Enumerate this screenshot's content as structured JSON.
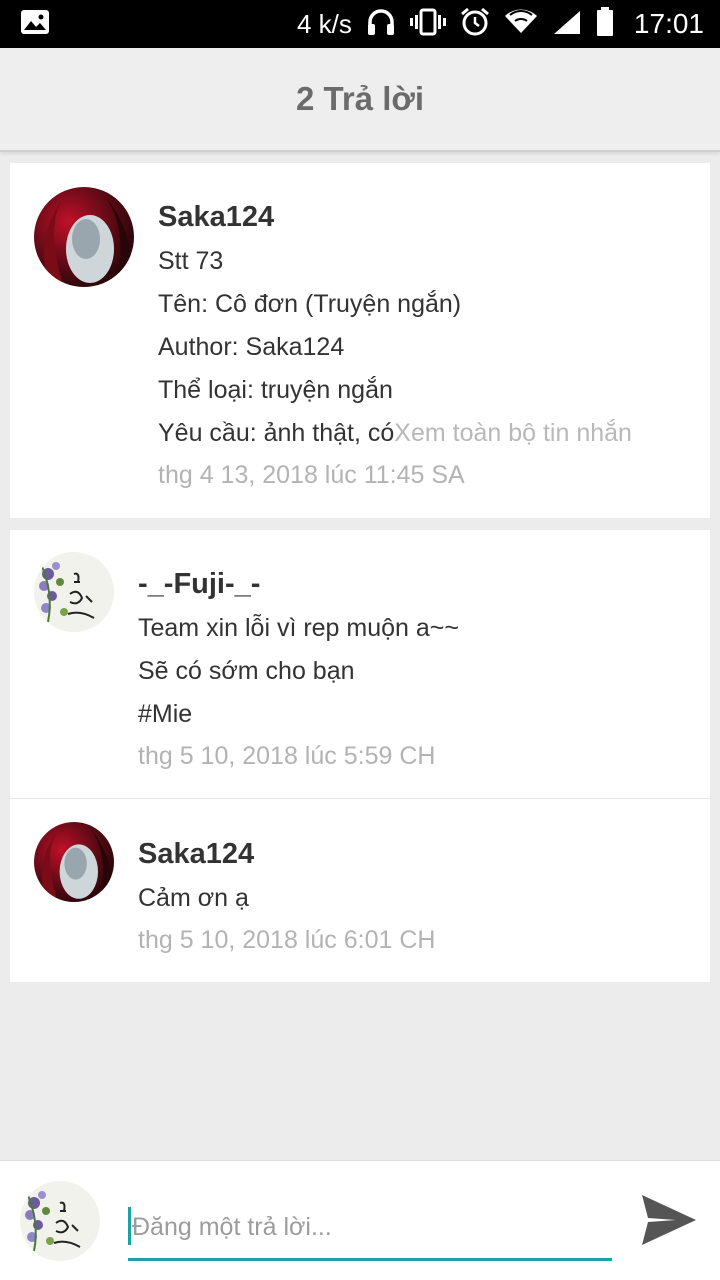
{
  "status_bar": {
    "speed": "4 k/s",
    "time": "17:01",
    "icons": [
      "image-icon",
      "headphones-icon",
      "vibrate-icon",
      "alarm-icon",
      "wifi-icon",
      "signal-icon",
      "battery-icon"
    ]
  },
  "header": {
    "title": "2 Trả lời"
  },
  "original_post": {
    "author": "Saka124",
    "lines": [
      "Stt 73",
      "Tên: Cô đơn (Truyện ngắn)",
      "Author: Saka124",
      "Thể loại: truyện ngắn"
    ],
    "last_line": "Yêu cầu: ảnh thật, có",
    "see_more": "Xem toàn bộ tin nhắn",
    "timestamp": "thg 4 13, 2018 lúc 11:45 SA"
  },
  "replies": [
    {
      "author": "-_-Fuji-_-",
      "lines": [
        "Team xin lỗi vì rep muộn a~~",
        "Sẽ có sớm cho bạn",
        "#Mie"
      ],
      "timestamp": "thg 5 10, 2018 lúc 5:59 CH"
    },
    {
      "author": "Saka124",
      "lines": [
        "Cảm ơn ạ"
      ],
      "timestamp": "thg 5 10, 2018 lúc 6:01 CH"
    }
  ],
  "composer": {
    "placeholder": "Đăng một trả lời...",
    "value": ""
  },
  "colors": {
    "accent": "#1aa3a3",
    "background": "#ececec",
    "header_text": "#6b6b6b",
    "timestamp": "#b3b3b3"
  }
}
